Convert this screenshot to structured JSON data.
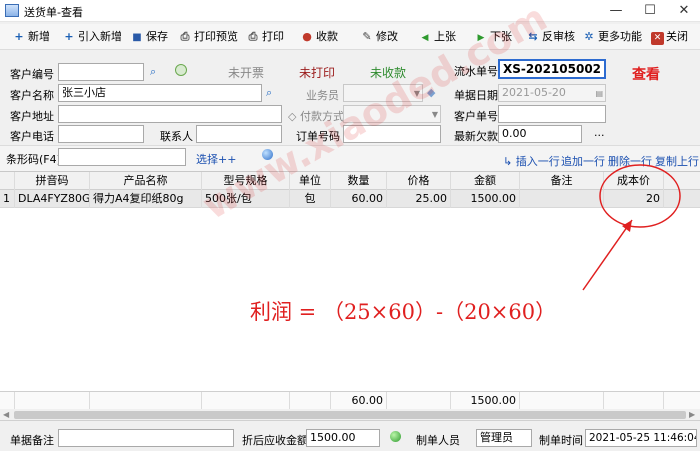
{
  "window": {
    "title": "送货单-查看",
    "controls": [
      "—",
      "☐",
      "✕"
    ]
  },
  "toolbar": [
    {
      "label": "新增",
      "icon": "plus-icon",
      "glyph": "+",
      "color": "#1a5fb4"
    },
    {
      "label": "引入新增",
      "icon": "plus-icon",
      "glyph": "+",
      "color": "#1a5fb4"
    },
    {
      "label": "保存",
      "icon": "save-icon",
      "glyph": "■",
      "color": "#2a5aa8"
    },
    {
      "label": "打印预览",
      "icon": "print-preview-icon",
      "glyph": "⎙",
      "color": "#555555"
    },
    {
      "label": "打印",
      "icon": "print-icon",
      "glyph": "⎙",
      "color": "#555555"
    },
    {
      "label": "收款",
      "icon": "payment-icon",
      "glyph": "●",
      "color": "#c0392b"
    },
    {
      "label": "修改",
      "icon": "edit-icon",
      "glyph": "✎",
      "color": "#444444"
    },
    {
      "label": "上张",
      "icon": "prev-icon",
      "glyph": "◀",
      "color": "#2e9a2e"
    },
    {
      "label": "下张",
      "icon": "next-icon",
      "glyph": "▶",
      "color": "#2e9a2e"
    },
    {
      "label": "反审核",
      "icon": "unaudit-icon",
      "glyph": "⇆",
      "color": "#1a5fb4"
    },
    {
      "label": "更多功能",
      "icon": "more-functions-icon",
      "glyph": "✲",
      "color": "#1a5fb4"
    },
    {
      "label": "关闭",
      "icon": "close-icon",
      "glyph": "✕",
      "color": "#ffffff"
    }
  ],
  "form": {
    "customer_code_label": "客户编号",
    "customer_code": "",
    "customer_name_label": "客户名称",
    "customer_name": "张三小店",
    "customer_addr_label": "客户地址",
    "customer_addr": "",
    "customer_phone_label": "客户电话",
    "customer_phone": "",
    "contact_label": "联系人",
    "contact": "",
    "status_invoice": "未开票",
    "status_print": "未打印",
    "status_collect": "未收款",
    "salesman_label": "业务员",
    "salesman": "",
    "payment_method_label": "付款方式",
    "payment_method": "",
    "order_no_label": "订单号码",
    "order_no": "",
    "serial_label": "流水单号",
    "serial": "XS-202105002",
    "date_label": "单据日期",
    "date": "2021-05-20",
    "customer_no_label": "客户单号",
    "customer_no": "",
    "latest_owed_label": "最新欠款",
    "latest_owed": "0.00",
    "latest_owed_more": "...",
    "view_mark": "查看"
  },
  "barcode": {
    "label": "条形码(F4)",
    "value": "",
    "select_link": "选择++"
  },
  "row_actions": [
    "插入一行",
    "追加一行",
    "删除一行",
    "复制上行"
  ],
  "table": {
    "columns": [
      "拼音码",
      "产品名称",
      "型号规格",
      "单位",
      "数量",
      "价格",
      "金额",
      "备注",
      "成本价"
    ],
    "rows": [
      {
        "index": "1",
        "cells": [
          "DLA4FYZ80G",
          "得力A4复印纸80g",
          "500张/包",
          "包",
          "60.00",
          "25.00",
          "1500.00",
          "",
          "20"
        ]
      }
    ],
    "totals": {
      "quantity": "60.00",
      "amount": "1500.00"
    }
  },
  "footer": {
    "remark_label": "单据备注",
    "remark": "",
    "discount_label": "折后应收金额",
    "discount_amount": "1500.00",
    "maker_label": "制单人员",
    "maker": "管理员",
    "time_label": "制单时间",
    "time": "2021-05-25 11:46:04"
  },
  "annotation": {
    "formula": "利润 = （25×60）-（20×60）",
    "watermark": "www.xiaoded.com",
    "color": "#e02020"
  }
}
